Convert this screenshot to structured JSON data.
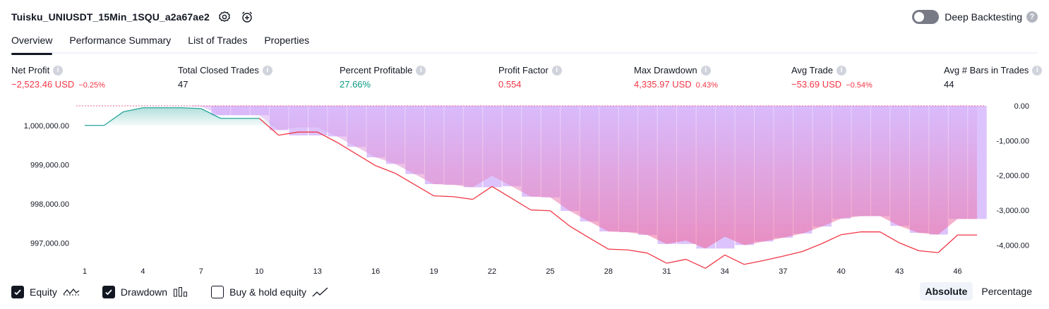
{
  "header": {
    "strategy_title": "Tuisku_UNIUSDT_15Min_1SQU_a2a67ae2",
    "deep_backtesting_label": "Deep Backtesting",
    "deep_backtesting_on": false
  },
  "tabs": [
    {
      "label": "Overview",
      "active": true
    },
    {
      "label": "Performance Summary",
      "active": false
    },
    {
      "label": "List of Trades",
      "active": false
    },
    {
      "label": "Properties",
      "active": false
    }
  ],
  "metrics": [
    {
      "label": "Net Profit",
      "value": "−2,523.46 USD",
      "sub": "−0.25%",
      "color": "red"
    },
    {
      "label": "Total Closed Trades",
      "value": "47",
      "sub": "",
      "color": "dark"
    },
    {
      "label": "Percent Profitable",
      "value": "27.66%",
      "sub": "",
      "color": "green"
    },
    {
      "label": "Profit Factor",
      "value": "0.554",
      "sub": "",
      "color": "red"
    },
    {
      "label": "Max Drawdown",
      "value": "4,335.97 USD",
      "sub": "0.43%",
      "color": "red"
    },
    {
      "label": "Avg Trade",
      "value": "−53.69 USD",
      "sub": "−0.54%",
      "color": "red"
    },
    {
      "label": "Avg # Bars in Trades",
      "value": "44",
      "sub": "",
      "color": "dark"
    }
  ],
  "legend": {
    "equity_label": "Equity",
    "equity_checked": true,
    "drawdown_label": "Drawdown",
    "drawdown_checked": true,
    "buyhold_label": "Buy & hold equity",
    "buyhold_checked": false
  },
  "scale_buttons": {
    "absolute_label": "Absolute",
    "percentage_label": "Percentage",
    "active": "absolute"
  },
  "colors": {
    "equity_profit_line": "#26a69a",
    "equity_loss_line": "#f23645",
    "drawdown_bar": "#d7b8fb",
    "accent": "#131722"
  },
  "chart_data": {
    "type": "area",
    "x_tick_labels": [
      "1",
      "4",
      "7",
      "10",
      "13",
      "16",
      "19",
      "22",
      "25",
      "28",
      "31",
      "34",
      "37",
      "40",
      "43",
      "46"
    ],
    "left_axis_labels": [
      "1,000,000.00",
      "999,000.00",
      "998,000.00",
      "997,000.00"
    ],
    "right_axis_labels": [
      "0.00",
      "-1,000.00",
      "-2,000.00",
      "-3,000.00",
      "-4,000.00"
    ],
    "left_axis_ticks": [
      1000000,
      999000,
      998000,
      997000
    ],
    "right_axis_ticks": [
      0,
      -1000,
      -2000,
      -3000,
      -4000
    ],
    "ylim_left": [
      996500,
      1000500
    ],
    "ylim_right": [
      -4500,
      0
    ],
    "initial_capital": 1000000,
    "trades": [
      1,
      2,
      3,
      4,
      5,
      6,
      7,
      8,
      9,
      10,
      11,
      12,
      13,
      14,
      15,
      16,
      17,
      18,
      19,
      20,
      21,
      22,
      23,
      24,
      25,
      26,
      27,
      28,
      29,
      30,
      31,
      32,
      33,
      34,
      35,
      36,
      37,
      38,
      39,
      40,
      41,
      42,
      43,
      44,
      45,
      46,
      47
    ],
    "equity": [
      1000000,
      1000000,
      1000350,
      1000450,
      1000450,
      1000450,
      1000430,
      1000180,
      1000180,
      1000180,
      999750,
      999830,
      999830,
      999570,
      999270,
      998970,
      998780,
      998490,
      998200,
      998180,
      998110,
      998440,
      998140,
      997840,
      997820,
      997430,
      997130,
      996840,
      996820,
      996740,
      996480,
      996580,
      996350,
      996690,
      996450,
      996550,
      996660,
      996780,
      996980,
      997210,
      997280,
      997280,
      997000,
      996800,
      996750,
      997200,
      997200
    ],
    "drawdown": [
      0,
      0,
      0,
      0,
      0,
      0,
      -20,
      -270,
      -270,
      -270,
      -700,
      -620,
      -620,
      -880,
      -1180,
      -1480,
      -1670,
      -1960,
      -2250,
      -2270,
      -2340,
      -2010,
      -2310,
      -2610,
      -2630,
      -3020,
      -3320,
      -3610,
      -3630,
      -3710,
      -3970,
      -3870,
      -4100,
      -3760,
      -4000,
      -3900,
      -3790,
      -3670,
      -3470,
      -3240,
      -3170,
      -3170,
      -3450,
      -3650,
      -3700,
      -3250,
      -3250
    ],
    "drawdown_bars": [
      0,
      0,
      0,
      0,
      0,
      0,
      -20,
      -270,
      -270,
      -270,
      -700,
      -850,
      -850,
      -880,
      -1180,
      -1480,
      -1670,
      -1960,
      -2250,
      -2270,
      -2340,
      -2340,
      -2310,
      -2610,
      -2630,
      -3020,
      -3320,
      -3610,
      -3630,
      -3710,
      -3970,
      -3970,
      -4100,
      -4100,
      -4000,
      -3900,
      -3790,
      -3670,
      -3470,
      -3240,
      -3170,
      -3170,
      -3450,
      -3650,
      -3700,
      -3250,
      -3250
    ],
    "equity_line_color_profit": "#26a69a",
    "equity_line_color_loss": "#f23645",
    "grid": false
  }
}
